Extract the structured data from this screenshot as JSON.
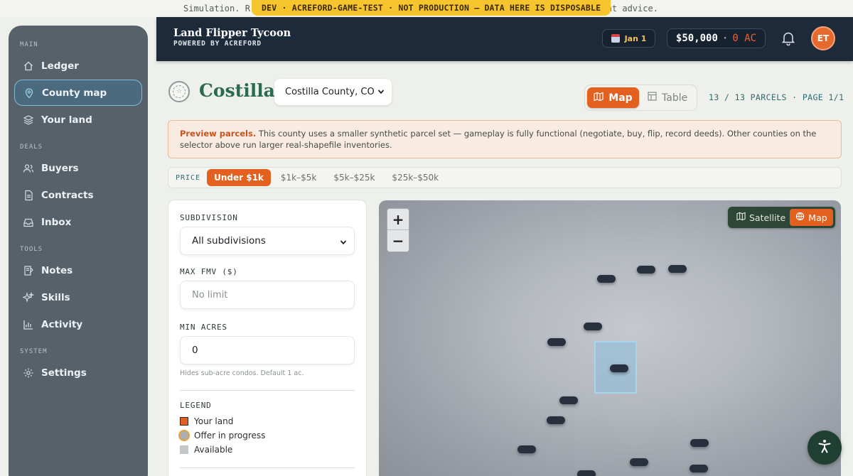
{
  "banner": {
    "sim_text_left": "Simulation. R",
    "sim_text_right": "tment advice.",
    "dev_badge": "DEV · ACREFORD-GAME-TEST · NOT PRODUCTION — DATA HERE IS DISPOSABLE"
  },
  "header": {
    "title": "Land Flipper Tycoon",
    "subtitle": "POWERED BY ACREFORD",
    "date": "Jan 1",
    "cash": "$50,000",
    "cash_sep": "·",
    "acres": "0 AC",
    "avatar_initials": "ET"
  },
  "sidebar": {
    "sections": [
      {
        "label": "MAIN",
        "items": [
          {
            "label": "Ledger",
            "icon": "home-icon"
          },
          {
            "label": "County map",
            "icon": "map-pin-icon",
            "active": true
          },
          {
            "label": "Your land",
            "icon": "layers-icon"
          }
        ]
      },
      {
        "label": "DEALS",
        "items": [
          {
            "label": "Buyers",
            "icon": "users-icon"
          },
          {
            "label": "Contracts",
            "icon": "document-icon"
          },
          {
            "label": "Inbox",
            "icon": "inbox-icon"
          }
        ]
      },
      {
        "label": "TOOLS",
        "items": [
          {
            "label": "Notes",
            "icon": "notes-icon"
          },
          {
            "label": "Skills",
            "icon": "sparkles-icon"
          },
          {
            "label": "Activity",
            "icon": "bar-chart-icon"
          }
        ]
      },
      {
        "label": "SYSTEM",
        "items": [
          {
            "label": "Settings",
            "icon": "gear-icon"
          }
        ]
      }
    ]
  },
  "county": {
    "title": "Costilla",
    "selected": "Costilla County, CO"
  },
  "view_toggle": {
    "map": "Map",
    "table": "Table",
    "active": "Map"
  },
  "parcels_count": "13 / 13 PARCELS · PAGE 1/1",
  "notice": {
    "bold": "Preview parcels.",
    "text": " This county uses a smaller synthetic parcel set — gameplay is fully functional (negotiate, buy, flip, record deeds). Other counties on the selector above run larger real-shapefile inventories."
  },
  "price_filter": {
    "label": "PRICE",
    "options": [
      "Under $1k",
      "$1k–$5k",
      "$5k–$25k",
      "$25k–$50k"
    ],
    "active": "Under $1k"
  },
  "filters": {
    "subdivision_label": "SUBDIVISION",
    "subdivision_value": "All subdivisions",
    "max_fmv_label": "MAX FMV ($)",
    "max_fmv_placeholder": "No limit",
    "min_acres_label": "MIN ACRES",
    "min_acres_value": "0",
    "min_acres_hint": "Hides sub-acre condos. Default 1 ac.",
    "legend_label": "LEGEND",
    "legend": [
      {
        "label": "Your land",
        "color": "#e3601e"
      },
      {
        "label": "Offer in progress",
        "color": "#e7a23a"
      },
      {
        "label": "Available",
        "color": "#c3c7c9"
      }
    ]
  },
  "map": {
    "zoom_in": "+",
    "zoom_out": "−",
    "layer_satellite": "Satellite",
    "layer_map": "Map",
    "active_layer": "Map"
  },
  "colors": {
    "accent": "#e3601e",
    "header_bg": "#1d2a3a",
    "county_title": "#2a6a52",
    "sidebar_bg": "#56616a"
  }
}
